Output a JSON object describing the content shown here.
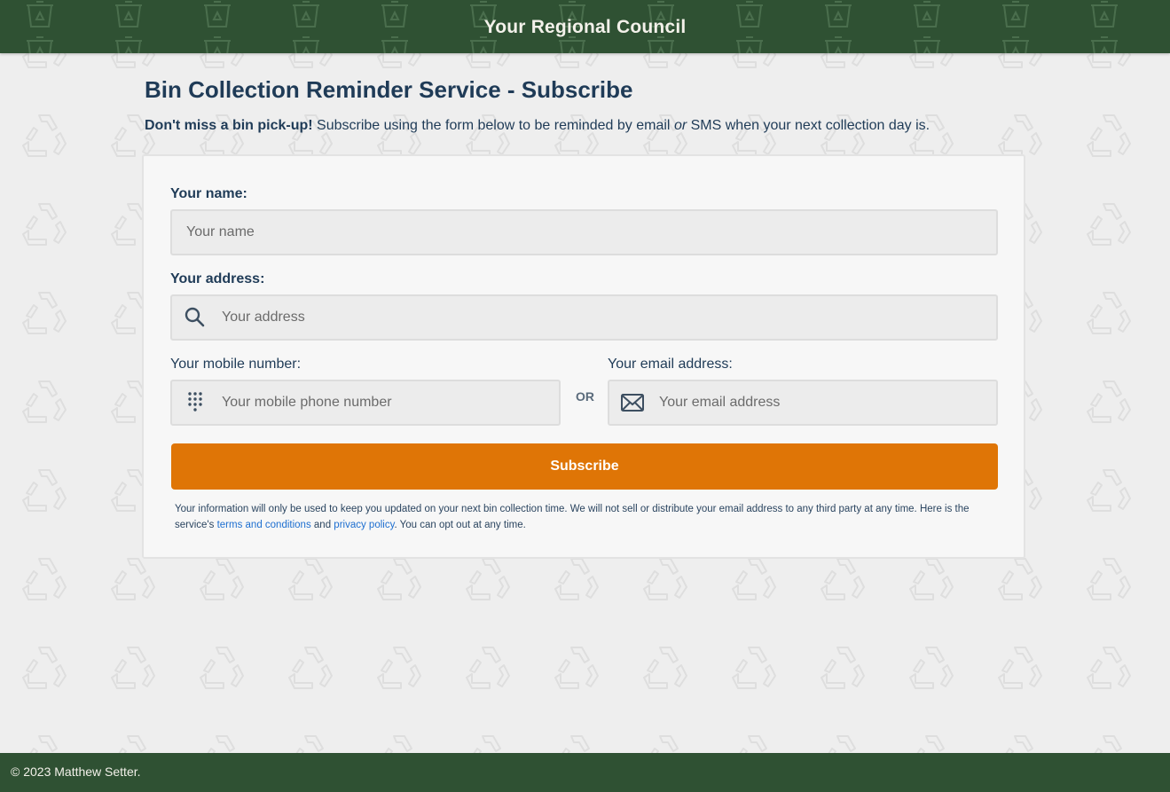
{
  "header": {
    "title": "Your Regional Council"
  },
  "page": {
    "title": "Bin Collection Reminder Service - Subscribe",
    "intro_bold": "Don't miss a bin pick-up!",
    "intro_text": "Subscribe using the form below to be reminded by email",
    "intro_or": "or",
    "intro_tail": "SMS when your next collection day is."
  },
  "form": {
    "name_label": "Your name:",
    "name_placeholder": "Your name",
    "address_label": "Your address:",
    "address_placeholder": "Your address",
    "mobile_label": "Your mobile number:",
    "mobile_placeholder": "Your mobile phone number",
    "or_label": "OR",
    "email_label": "Your email address:",
    "email_placeholder": "Your email address",
    "submit_label": "Subscribe"
  },
  "disclaimer": {
    "text_1": "Your information will only be used to keep you updated on your next bin collection time. We will not sell or distribute your email address to any third party at any time. Here is the service's",
    "terms_link": "terms and conditions",
    "and": "and",
    "privacy_link": "privacy policy",
    "text_2": ". You can opt out at any time."
  },
  "footer": {
    "copyright": "© 2023 Matthew Setter."
  },
  "icons": {
    "address": "search-icon",
    "mobile": "dialpad-icon",
    "email": "envelope-icon",
    "background": "recycle-icon",
    "header_pattern": "recycling-bin-icon"
  },
  "colors": {
    "header_bg": "#2f5133",
    "accent": "#df7506",
    "text": "#1f3b57",
    "link": "#1e6fd0",
    "page_bg": "#eeeeee"
  }
}
